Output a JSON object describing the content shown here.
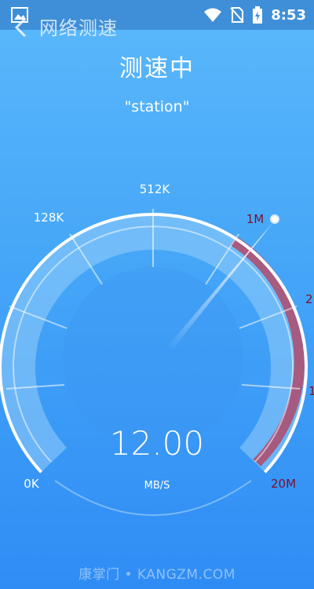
{
  "status_bar": {
    "time": "8:53"
  },
  "nav": {
    "title": "网络测速"
  },
  "header": {
    "status": "测速中",
    "network_name": "\"station\""
  },
  "gauge": {
    "labels": {
      "k0": "0K",
      "k128": "128K",
      "k512": "512K",
      "m1": "1M",
      "m2": "2",
      "m10": "1",
      "m20": "20M"
    },
    "speed_value": "12.00",
    "unit": "MB/S",
    "colors": {
      "accent": "#b04a6a",
      "ring": "#ffffff",
      "face": "#6cb9f6"
    }
  },
  "watermark": "康掌门 • KANGZM.COM"
}
